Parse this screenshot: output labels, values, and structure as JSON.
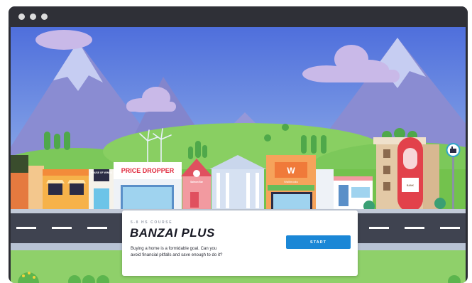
{
  "colors": {
    "sky_top": "#4f6fdc",
    "sky_bottom": "#b9d6f0",
    "mountain": "#8a8cd2",
    "snow": "#c6cdf2",
    "hill_green": "#73c24d",
    "road": "#3f4350",
    "card_bg": "#ffffff",
    "start_button": "#1b87d6"
  },
  "window": {
    "controls": [
      "window-dot",
      "window-dot",
      "window-dot"
    ]
  },
  "scene": {
    "signs": {
      "house_of_wings": "HOUSE OF WINGS",
      "price_dropper": "PRICE DROPPER",
      "salmon_bar": "Salmon Bar",
      "wallbrooks_logo": "W",
      "wallbrooks": "Wallbrooks",
      "sign_right": "BANK",
      "llama_icon": "llama-sign-icon"
    }
  },
  "course_card": {
    "eyebrow": "5-8 HS COURSE",
    "title": "BANZAI PLUS",
    "description": "Buying a home is a formidable goal. Can you avoid financial pitfalls and save enough to do it?",
    "start_label": "START"
  }
}
